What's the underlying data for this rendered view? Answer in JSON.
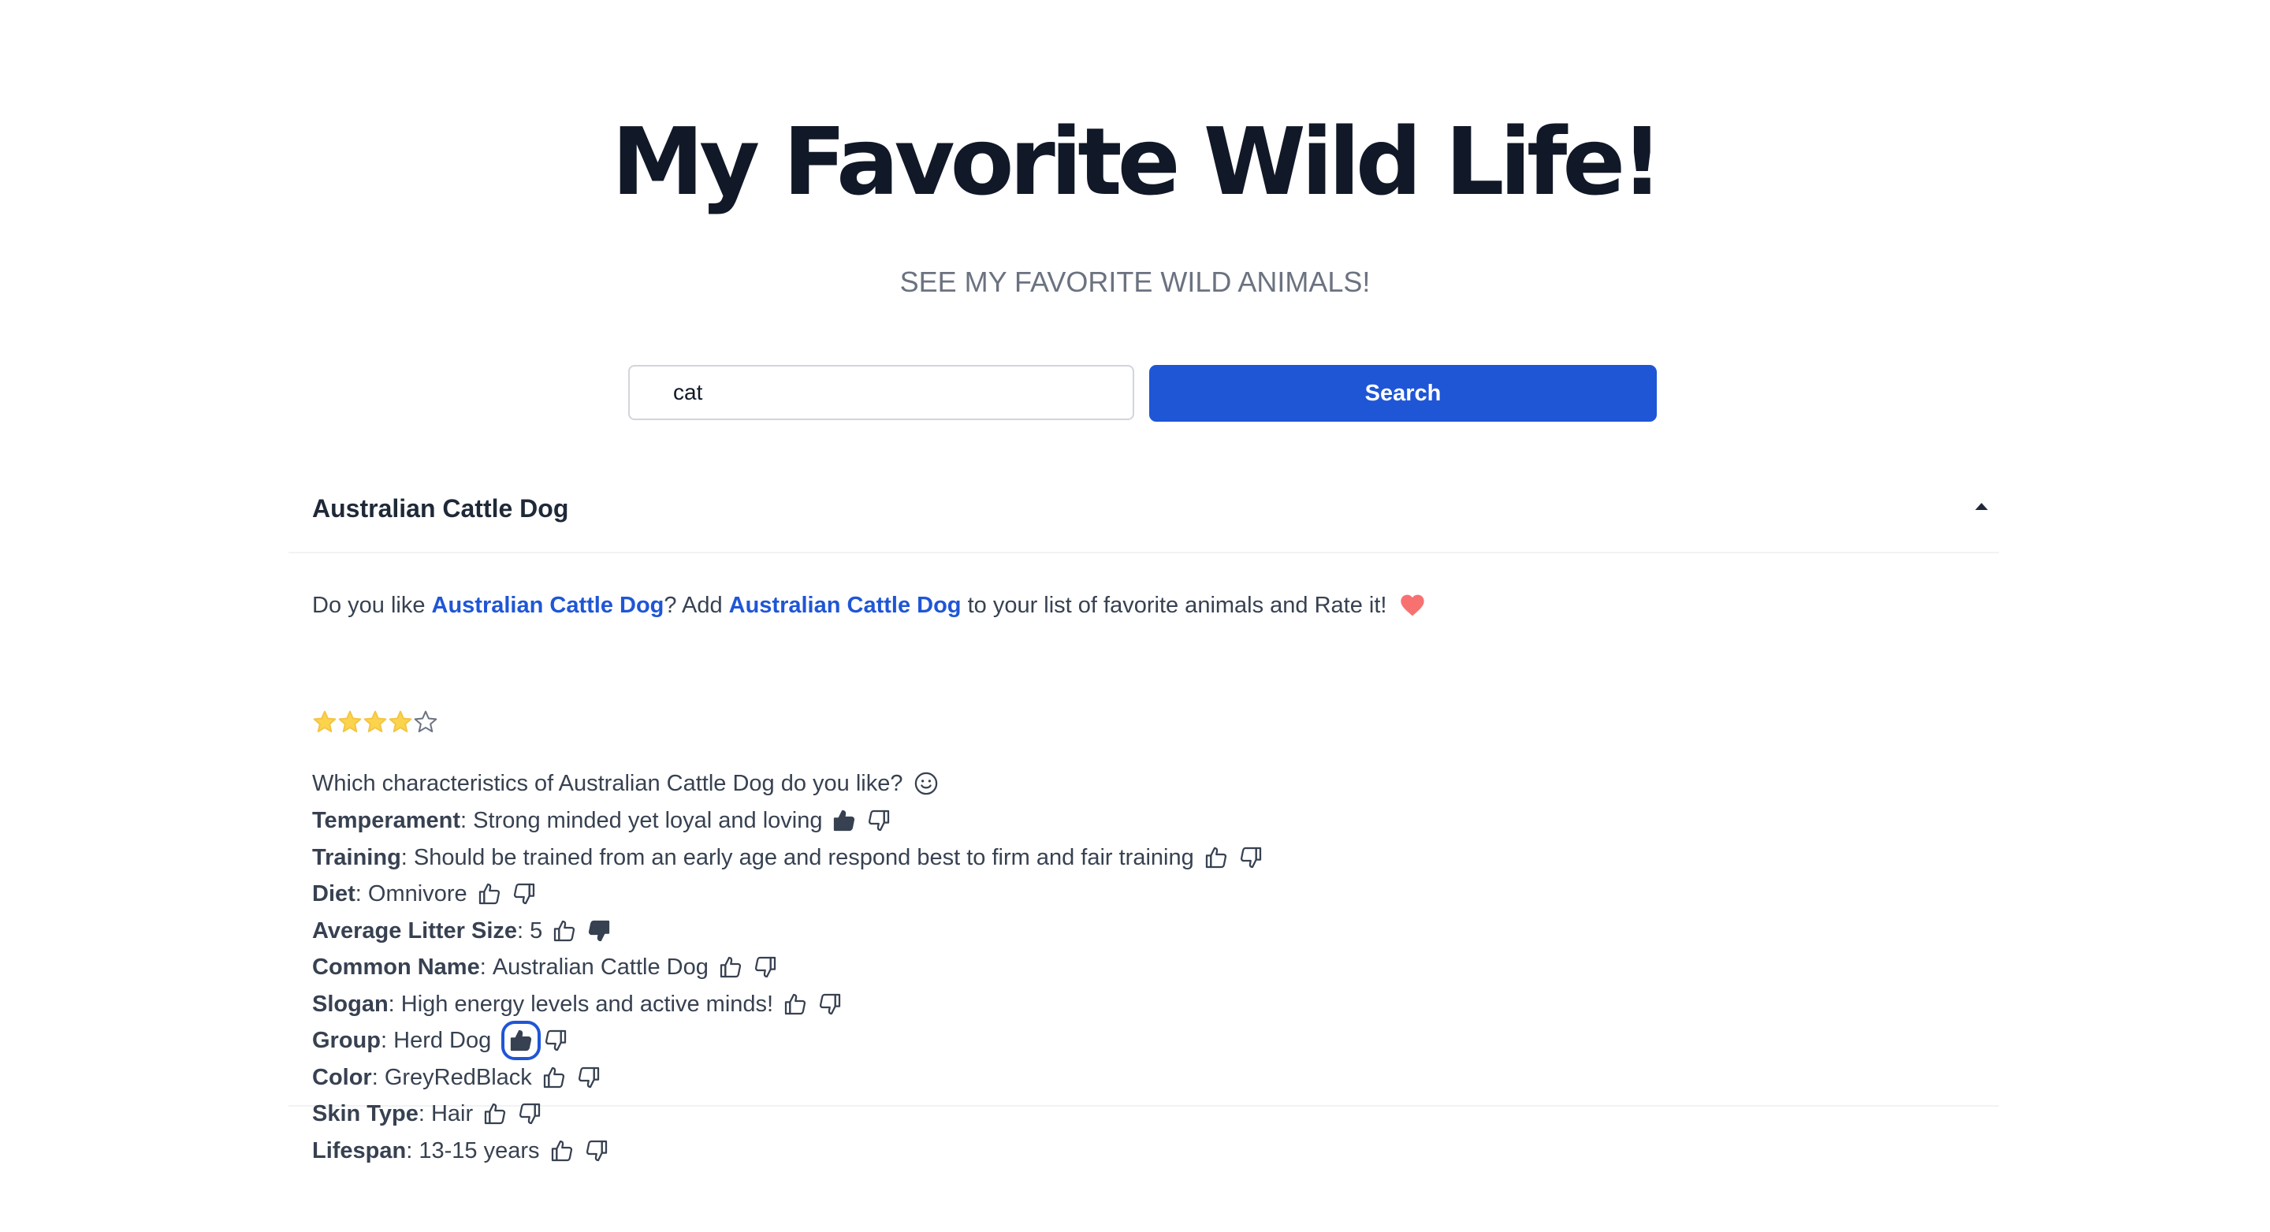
{
  "header": {
    "title": "My Favorite Wild Life!",
    "subtitle": "SEE MY FAVORITE WILD ANIMALS!"
  },
  "search": {
    "value": "cat",
    "button_label": "Search"
  },
  "result": {
    "name": "Australian Cattle Dog",
    "prompt_part1": "Do you like ",
    "prompt_link1": "Australian Cattle Dog",
    "prompt_part2": "? Add ",
    "prompt_link2": "Australian Cattle Dog",
    "prompt_part3": " to your list of favorite animals and Rate it!",
    "rating": 4,
    "rating_max": 5,
    "characteristics_prompt": "Which characteristics of Australian Cattle Dog do you like?",
    "characteristics": [
      {
        "label": "Temperament",
        "value": "Strong minded yet loyal and loving",
        "vote": "up"
      },
      {
        "label": "Training",
        "value": "Should be trained from an early age and respond best to firm and fair training",
        "vote": "none"
      },
      {
        "label": "Diet",
        "value": "Omnivore",
        "vote": "none"
      },
      {
        "label": "Average Litter Size",
        "value": "5",
        "vote": "down"
      },
      {
        "label": "Common Name",
        "value": "Australian Cattle Dog",
        "vote": "none"
      },
      {
        "label": "Slogan",
        "value": "High energy levels and active minds!",
        "vote": "none"
      },
      {
        "label": "Group",
        "value": "Herd Dog",
        "vote": "up"
      },
      {
        "label": "Color",
        "value": "GreyRedBlack",
        "vote": "none"
      },
      {
        "label": "Skin Type",
        "value": "Hair",
        "vote": "none"
      },
      {
        "label": "Lifespan",
        "value": "13-15 years",
        "vote": "none"
      }
    ]
  },
  "colors": {
    "accent": "#1f56d6",
    "star": "#fcd34d",
    "heart": "#f87171",
    "icon": "#374151"
  },
  "icons": {
    "expand": "caret-up-icon",
    "favorite": "heart-icon",
    "rating": "star-icon",
    "like": "thumbs-up-icon",
    "dislike": "thumbs-down-icon",
    "mood": "smile-icon"
  }
}
